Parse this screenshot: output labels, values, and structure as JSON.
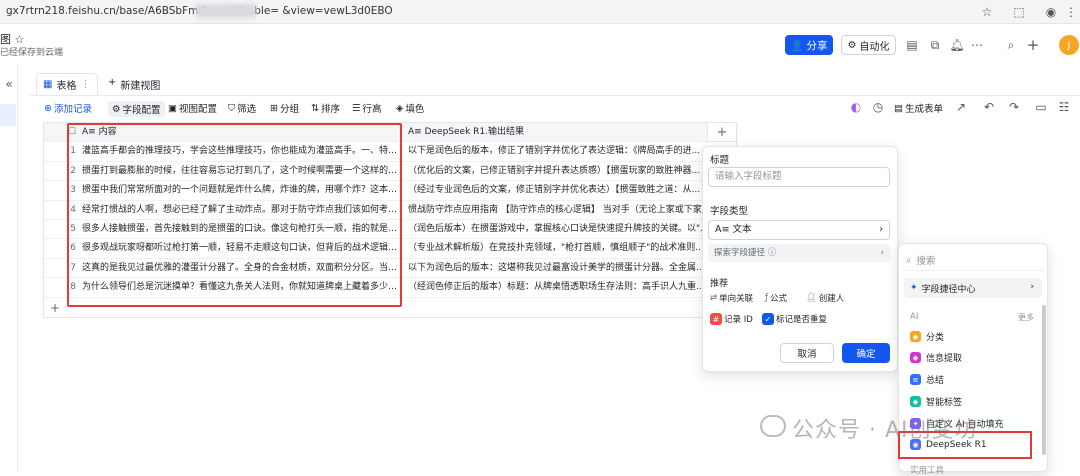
{
  "browser": {
    "url": "gx7rtrn218.feishu.cn/base/A6BSbFmi5ar                      siU?table=              &view=vewL3d0EBO"
  },
  "doc": {
    "title": "图 ☆",
    "subtitle": "已经保存到云端"
  },
  "header": {
    "share_label": "分享",
    "automation_label": "自动化",
    "avatar_letter": "J"
  },
  "tabs": {
    "table_label": "表格",
    "new_view_label": "新建视图"
  },
  "toolbar": {
    "add_record": "添加记录",
    "field_config": "字段配置",
    "view_config": "视图配置",
    "filter": "筛选",
    "group": "分组",
    "sort": "排序",
    "row_height": "行高",
    "fill": "填色",
    "gen_form": "生成表单"
  },
  "grid": {
    "col1_header": "内容",
    "col2_header": "DeepSeek R1.输出结果",
    "rows": [
      {
        "n": "1",
        "c1": "灌篮高手都会的推理技巧，学会这些推理技巧，你也能成为灌篮高手。一、特殊...",
        "c2": "以下是润色后的版本，修正了错别字并优化了表达逻辑：《牌局高手的进..."
      },
      {
        "n": "2",
        "c1": "掼蛋打到最膨胀的时候，往往容易忘记打到几了，这个时候啊需要一个这样的计...",
        "c2": "（优化后的文案，已修正错别字并提升表达质感）【掼蛋玩家的致胜神器..."
      },
      {
        "n": "3",
        "c1": "掼蛋中我们常常所面对的一个问题就是炸什么牌，炸谁的牌，用哪个炸？这本由...",
        "c2": "（经过专业润色后的文案，修正错别字并优化表达）【掼蛋致胜之道：从..."
      },
      {
        "n": "4",
        "c1": "经常打惯战的人啊，想必已经了解了主动炸点。那对于防守炸点我们该如何考虑...",
        "c2": "惯战防守炸点应用指南 【防守炸点的核心逻辑】 当对手（无论上家或下家..."
      },
      {
        "n": "5",
        "c1": "很多人接触掼蛋，首先接触到的是掼蛋的口诀。像这句枪打头一顺，指的就是如...",
        "c2": "（润色后版本）在掼蛋游戏中，掌握核心口诀是快速提升牌技的关键。以\"..."
      },
      {
        "n": "6",
        "c1": "很多观战玩家呀都听过枪打第一顺，轻易不走顺这句口诀，但背后的战术逻辑你...",
        "c2": "（专业战术解析版）在竞技扑克领域，\"枪打首顺，慎组顺子\"的战术准则..."
      },
      {
        "n": "7",
        "c1": "这真的是我见过最优雅的灌蛋计分器了。全身的合金材质，双面积分分区。当你...",
        "c2": "以下为润色后的版本：这堪称我见过最富设计美学的掼蛋计分器。全金属..."
      },
      {
        "n": "8",
        "c1": "为什么领导们总是沉迷摸单？看懂这九条关人法则，你就知道牌桌上藏着多少职...",
        "c2": "（经润色修正后的版本）标题：从牌桌悟透职场生存法则：高手识人九重..."
      }
    ]
  },
  "field_panel": {
    "title_label": "标题",
    "title_placeholder": "请输入字段标题",
    "type_label": "字段类型",
    "type_value": "文本",
    "explore_label": "探索字段捷径 ⓘ",
    "recommend_label": "推荐",
    "chips": [
      "单向关联",
      "公式",
      "创建人",
      "记录 ID",
      "标记是否重复"
    ],
    "cancel": "取消",
    "ok": "确定"
  },
  "dropdown": {
    "search_placeholder": "搜索",
    "center_label": "字段捷径中心",
    "ai_label": "AI",
    "more_label": "更多",
    "items": [
      "分类",
      "信息提取",
      "总结",
      "智能标签",
      "自定义 AI 自动填充",
      "DeepSeek R1"
    ],
    "footer_label": "实用工具"
  },
  "watermark": {
    "text": "公众号 · AI创变坊"
  },
  "colors": {
    "accent": "#1456f0",
    "highlight": "#e53935"
  }
}
